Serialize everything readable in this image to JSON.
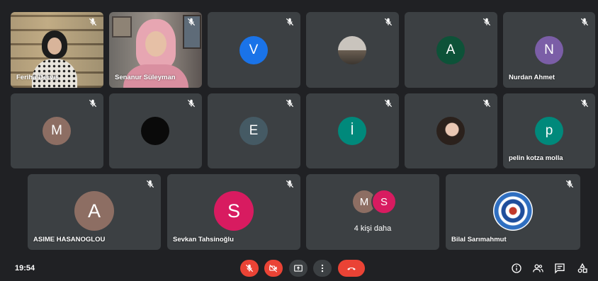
{
  "meeting": {
    "time": "19:54",
    "more_participants_label": "4 kişi daha",
    "more_participants_initials": [
      "M",
      "S"
    ]
  },
  "participants": [
    {
      "name": "Feriha Derviş",
      "type": "video"
    },
    {
      "name": "Senanur Süleyman",
      "type": "video"
    },
    {
      "name": "",
      "initial": "V",
      "color": "#1a73e8"
    },
    {
      "name": "",
      "type": "photo-avatar"
    },
    {
      "name": "",
      "initial": "A",
      "color": "#0d5238"
    },
    {
      "name": "Nurdan Ahmet",
      "initial": "N",
      "color": "#7b5ea7"
    },
    {
      "name": "",
      "initial": "M",
      "color": "#8d6e63"
    },
    {
      "name": "",
      "type": "black-avatar"
    },
    {
      "name": "",
      "initial": "E",
      "color": "#455a64"
    },
    {
      "name": "",
      "initial": "İ",
      "color": "#00897b"
    },
    {
      "name": "",
      "type": "photo-avatar"
    },
    {
      "name": "pelin kotza molla",
      "initial": "p",
      "color": "#00897b"
    },
    {
      "name": "ASIME HASANOGLOU",
      "initial": "A",
      "color": "#8d6e63"
    },
    {
      "name": "Sevkan Tahsinoğlu",
      "initial": "S",
      "color": "#d81b60"
    },
    {
      "name": "Bilal Sarımahmut",
      "type": "photo-avatar"
    }
  ],
  "colors": {
    "background": "#202124",
    "tile": "#3c4043",
    "danger": "#ea4335",
    "control": "#3c4043"
  },
  "icons": [
    "mic-off-icon",
    "video-off-icon",
    "present-icon",
    "more-icon",
    "hangup-icon",
    "info-icon",
    "people-icon",
    "chat-icon",
    "activities-icon"
  ]
}
